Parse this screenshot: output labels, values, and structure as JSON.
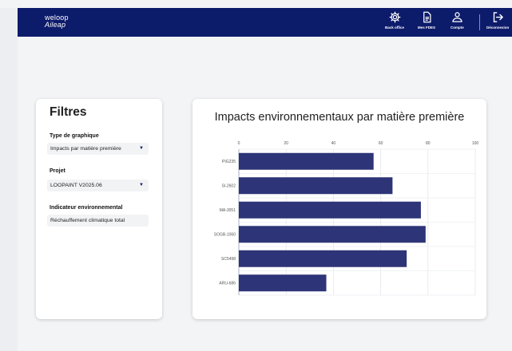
{
  "brand": {
    "line1": "weloop",
    "line2": "Aileap"
  },
  "nav": [
    {
      "label": "Back office",
      "icon": "gear-icon"
    },
    {
      "label": "Mes FDES",
      "icon": "document-icon"
    },
    {
      "label": "Compte",
      "icon": "user-icon"
    },
    {
      "label": "Déconnexion",
      "icon": "logout-icon"
    }
  ],
  "filters": {
    "title": "Filtres",
    "chart_type_label": "Type de graphique",
    "chart_type_value": "Impacts par matière première",
    "project_label": "Projet",
    "project_value": "LOOPAINT V2025.06",
    "indicator_label": "Indicateur environnemental",
    "indicator_value": "Réchauffement climatique total"
  },
  "chart_data": {
    "type": "bar",
    "orientation": "horizontal",
    "title": "Impacts environnementaux par matière première",
    "categories": [
      "PIG235",
      "SI-2602",
      "MA-3051",
      "SOGB-1060",
      "SC5498",
      "ARU-686"
    ],
    "values": [
      57,
      65,
      77,
      79,
      71,
      37
    ],
    "xlim": [
      0,
      100
    ],
    "xticks": [
      "0",
      "20",
      "40",
      "60",
      "80",
      "100"
    ],
    "grid": true,
    "color": "#2d3477"
  }
}
